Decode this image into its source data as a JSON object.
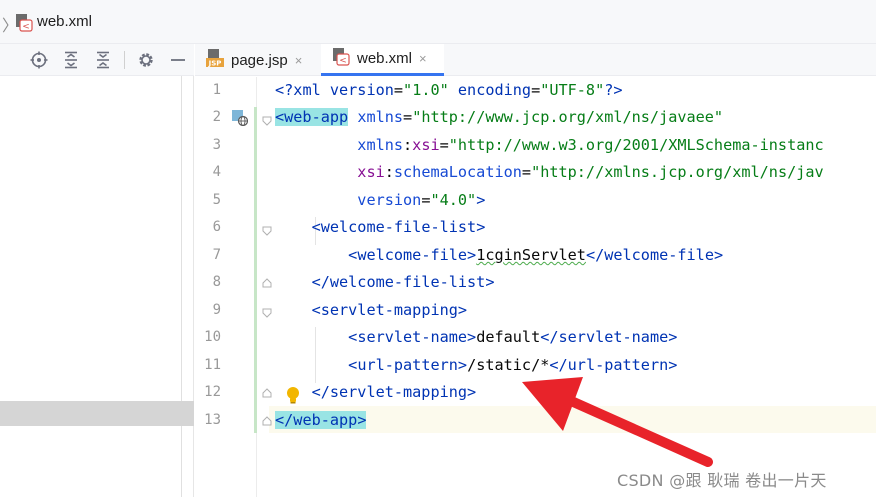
{
  "breadcrumb": {
    "file": "web.xml"
  },
  "tabs": [
    {
      "label": "page.jsp",
      "icon": "jsp-file-icon",
      "close": "×"
    },
    {
      "label": "web.xml",
      "icon": "xml-file-icon",
      "close": "×"
    }
  ],
  "icon_labels": {
    "jsp": "JSP",
    "xml": "<"
  },
  "line_numbers": [
    "1",
    "2",
    "3",
    "4",
    "5",
    "6",
    "7",
    "8",
    "9",
    "10",
    "11",
    "12",
    "13"
  ],
  "code": {
    "l1": {
      "a": "<?",
      "b": "xml version",
      "c": "=",
      "d": "\"1.0\"",
      "e": " encoding",
      "f": "=",
      "g": "\"UTF-8\"",
      "h": "?>"
    },
    "l2": {
      "open": "<web-app",
      "attr": "xmlns",
      "eq": "=",
      "val": "\"http://www.jcp.org/xml/ns/javaee\""
    },
    "l3": {
      "ns": "xmlns",
      "colon": ":",
      "attr": "xsi",
      "eq": "=",
      "val": "\"http://www.w3.org/2001/XMLSchema-instanc"
    },
    "l4": {
      "ns": "xsi",
      "colon": ":",
      "attr": "schemaLocation",
      "eq": "=",
      "val": "\"http://xmlns.jcp.org/xml/ns/jav"
    },
    "l5": {
      "attr": "version",
      "eq": "=",
      "val": "\"4.0\"",
      "close": ">"
    },
    "l6": {
      "lt": "<",
      "tag": "welcome-file-list",
      "gt": ">"
    },
    "l7": {
      "lt": "<",
      "tag": "welcome-file",
      "gt": ">",
      "text": "1cginServlet",
      "lt2": "</",
      "tag2": "welcome-file",
      "gt2": ">"
    },
    "l8": {
      "lt": "</",
      "tag": "welcome-file-list",
      "gt": ">"
    },
    "l9": {
      "lt": "<",
      "tag": "servlet-mapping",
      "gt": ">"
    },
    "l10": {
      "lt": "<",
      "tag": "servlet-name",
      "gt": ">",
      "text": "default",
      "lt2": "</",
      "tag2": "servlet-name",
      "gt2": ">"
    },
    "l11": {
      "lt": "<",
      "tag": "url-pattern",
      "gt": ">",
      "text": "/static/*",
      "lt2": "</",
      "tag2": "url-pattern",
      "gt2": ">"
    },
    "l12": {
      "lt": "</",
      "tag": "servlet-mapping",
      "gt": ">"
    },
    "l13": {
      "lt": "</",
      "tag": "web-app",
      "gt": ">"
    }
  },
  "watermark": "CSDN @跟 耿瑞 卷出一片天",
  "colors": {
    "tag": "#0033b3",
    "attribute": "#174ad4",
    "namespace": "#871094",
    "string": "#067d17",
    "tag_highlight": "#99e4e4",
    "annotation_arrow": "#e8232a",
    "active_tab_underline": "#3574f0"
  }
}
